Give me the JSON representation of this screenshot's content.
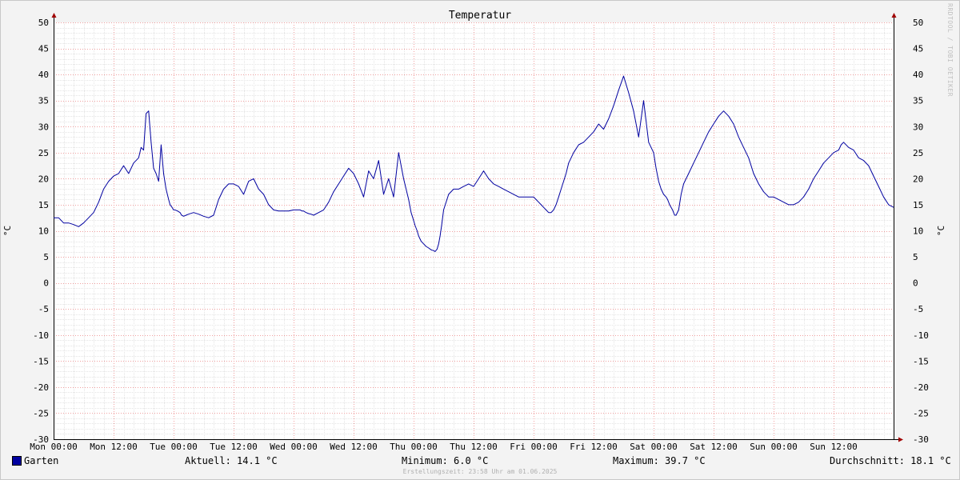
{
  "chart_data": {
    "type": "line",
    "title": "Temperatur",
    "ylabel": "°C",
    "ylim": [
      -30,
      50
    ],
    "yticks": [
      "50",
      "45",
      "40",
      "35",
      "30",
      "25",
      "20",
      "15",
      "10",
      "5",
      "0",
      "-5",
      "-10",
      "-15",
      "-20",
      "-25",
      "-30"
    ],
    "xticks": [
      "Mon 00:00",
      "Mon 12:00",
      "Tue 00:00",
      "Tue 12:00",
      "Wed 00:00",
      "Wed 12:00",
      "Thu 00:00",
      "Thu 12:00",
      "Fri 00:00",
      "Fri 12:00",
      "Sat 00:00",
      "Sat 12:00",
      "Sun 00:00",
      "Sun 12:00"
    ],
    "xlim_hours": [
      0,
      168
    ],
    "grid": true,
    "series": [
      {
        "name": "Garten",
        "color": "#0000a0",
        "x_hours": [
          0,
          1,
          2,
          3,
          4,
          5,
          6,
          7,
          8,
          9,
          10,
          11,
          12,
          13,
          14,
          15,
          16,
          17,
          17.5,
          18,
          18.5,
          19,
          19.5,
          20,
          20.5,
          21,
          21.5,
          22,
          22.5,
          23,
          23.3,
          23.7,
          24,
          24.3,
          24.8,
          25.3,
          25.6,
          26,
          26.5,
          27,
          28,
          29,
          30,
          31,
          32,
          33,
          34,
          35,
          36,
          37,
          38,
          39,
          40,
          41,
          42,
          43,
          44,
          45,
          46,
          47,
          48,
          48.3,
          48.7,
          49,
          49.3,
          49.7,
          50,
          50.5,
          51,
          51.5,
          52,
          53,
          54,
          55,
          56,
          57,
          58,
          59,
          60,
          61,
          62,
          63,
          64,
          65,
          66,
          67,
          68,
          69,
          70,
          71,
          71.5,
          72,
          72.3,
          72.7,
          73,
          73.5,
          74,
          74.5,
          75,
          75.3,
          75.6,
          76,
          76.3,
          76.7,
          77,
          77.3,
          77.6,
          78,
          79,
          80,
          81,
          82,
          83,
          84,
          85,
          86,
          87,
          88,
          89,
          90,
          91,
          92,
          93,
          94,
          95,
          96,
          96.5,
          97,
          97.5,
          98,
          98.5,
          99,
          99.5,
          100,
          100.5,
          101,
          101.5,
          102,
          102.5,
          103,
          104,
          105,
          106,
          107,
          108,
          109,
          110,
          111,
          112,
          113,
          114,
          115,
          116,
          117,
          118,
          119,
          120,
          120.5,
          121,
          121.5,
          122,
          122.5,
          122.8,
          123,
          123.2,
          123.5,
          123.8,
          124,
          124.2,
          124.5,
          125,
          125.5,
          126,
          127,
          128,
          129,
          130,
          131,
          132,
          133,
          134,
          135,
          136,
          137,
          138,
          139,
          140,
          141,
          142,
          143,
          144,
          145,
          146,
          147,
          148,
          149,
          150,
          151,
          152,
          153,
          154,
          155,
          156,
          157,
          157.5,
          158,
          159,
          160,
          161,
          162,
          163,
          164,
          165,
          166,
          167,
          168
        ],
        "y": [
          12.5,
          12.5,
          11.5,
          11.5,
          11.2,
          10.8,
          11.5,
          12.5,
          13.5,
          15.5,
          18,
          19.5,
          20.5,
          21,
          22.5,
          21,
          23,
          24,
          26,
          25.5,
          32.5,
          33,
          27,
          22,
          21,
          19.5,
          26.5,
          21,
          18,
          16,
          15,
          14.5,
          14,
          14,
          13.8,
          13.5,
          13,
          12.8,
          13,
          13.2,
          13.5,
          13.2,
          12.8,
          12.5,
          13,
          16,
          18,
          19,
          19,
          18.5,
          17,
          19.5,
          20,
          18,
          17,
          15,
          14,
          13.8,
          13.8,
          13.8,
          14,
          14,
          14,
          14,
          14,
          13.8,
          13.8,
          13.5,
          13.3,
          13.2,
          13,
          13.5,
          14,
          15.5,
          17.5,
          19,
          20.5,
          22,
          21,
          19,
          16.5,
          21.5,
          20,
          23.5,
          17,
          20,
          16.5,
          25,
          20,
          16,
          13.5,
          12,
          11,
          10,
          9,
          8,
          7.5,
          7,
          6.7,
          6.5,
          6.3,
          6.2,
          6.0,
          6.5,
          7.5,
          9,
          11,
          14,
          17,
          18,
          18,
          18.5,
          19,
          18.5,
          20,
          21.5,
          20,
          19,
          18.5,
          18,
          17.5,
          17,
          16.5,
          16.5,
          16.5,
          16.5,
          16,
          15.5,
          15,
          14.5,
          14,
          13.5,
          13.5,
          14,
          15,
          16.5,
          18,
          19.5,
          21,
          23,
          25,
          26.5,
          27,
          28,
          29,
          30.5,
          29.5,
          31.5,
          34,
          37,
          39.7,
          36.5,
          33,
          28,
          35,
          27,
          25,
          22,
          19.5,
          18,
          17,
          16.5,
          16,
          15.5,
          15,
          14.5,
          14,
          13.5,
          13,
          13,
          14,
          17,
          19,
          21,
          23,
          25,
          27,
          29,
          30.5,
          32,
          33,
          32,
          30.5,
          28,
          26,
          24,
          21,
          19,
          17.5,
          16.5,
          16.5,
          16,
          15.5,
          15,
          15,
          15.5,
          16.5,
          18,
          20,
          21.5,
          23,
          24,
          25,
          25.5,
          26.5,
          27,
          26,
          25.5,
          24,
          23.5,
          22.5,
          20.5,
          18.5,
          16.5,
          15,
          14.5,
          14.1
        ]
      }
    ]
  },
  "watermark": "RRDTOOL / TOBI OETIKER",
  "legend": {
    "series_name": "Garten",
    "current": "Aktuell: 14.1 °C",
    "minimum": "Minimum: 6.0 °C",
    "maximum": "Maximum: 39.7 °C",
    "average": "Durchschnitt: 18.1 °C"
  },
  "created": "Erstellungszeit: 23:58 Uhr am 01.06.2025"
}
